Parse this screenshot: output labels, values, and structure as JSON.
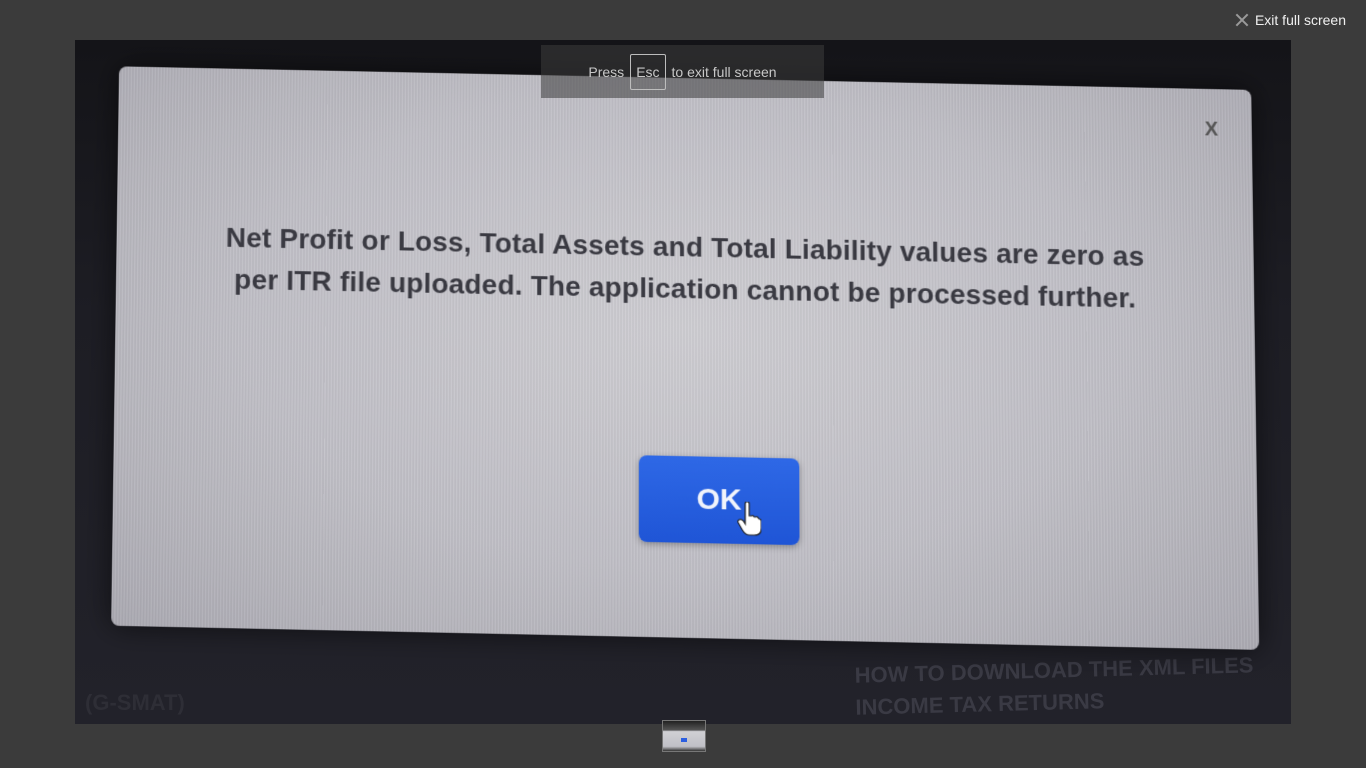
{
  "viewer": {
    "exit_label": "Exit full screen"
  },
  "esc_hint": {
    "prefix": "Press",
    "key": "Esc",
    "suffix": "to exit full screen"
  },
  "dialog": {
    "close_label": "X",
    "message": "Net Profit or Loss, Total Assets and Total Liability values are zero as per ITR file uploaded. The application cannot be processed further.",
    "ok_label": "OK"
  },
  "background_page": {
    "heading": "HOW TO DOWNLOAD THE XML FILES INCOME TAX RETURNS",
    "left_fragment": "(G-SMAT)"
  },
  "colors": {
    "ok_button": "#1f55d6",
    "viewer_bg": "#3b3b3b"
  }
}
